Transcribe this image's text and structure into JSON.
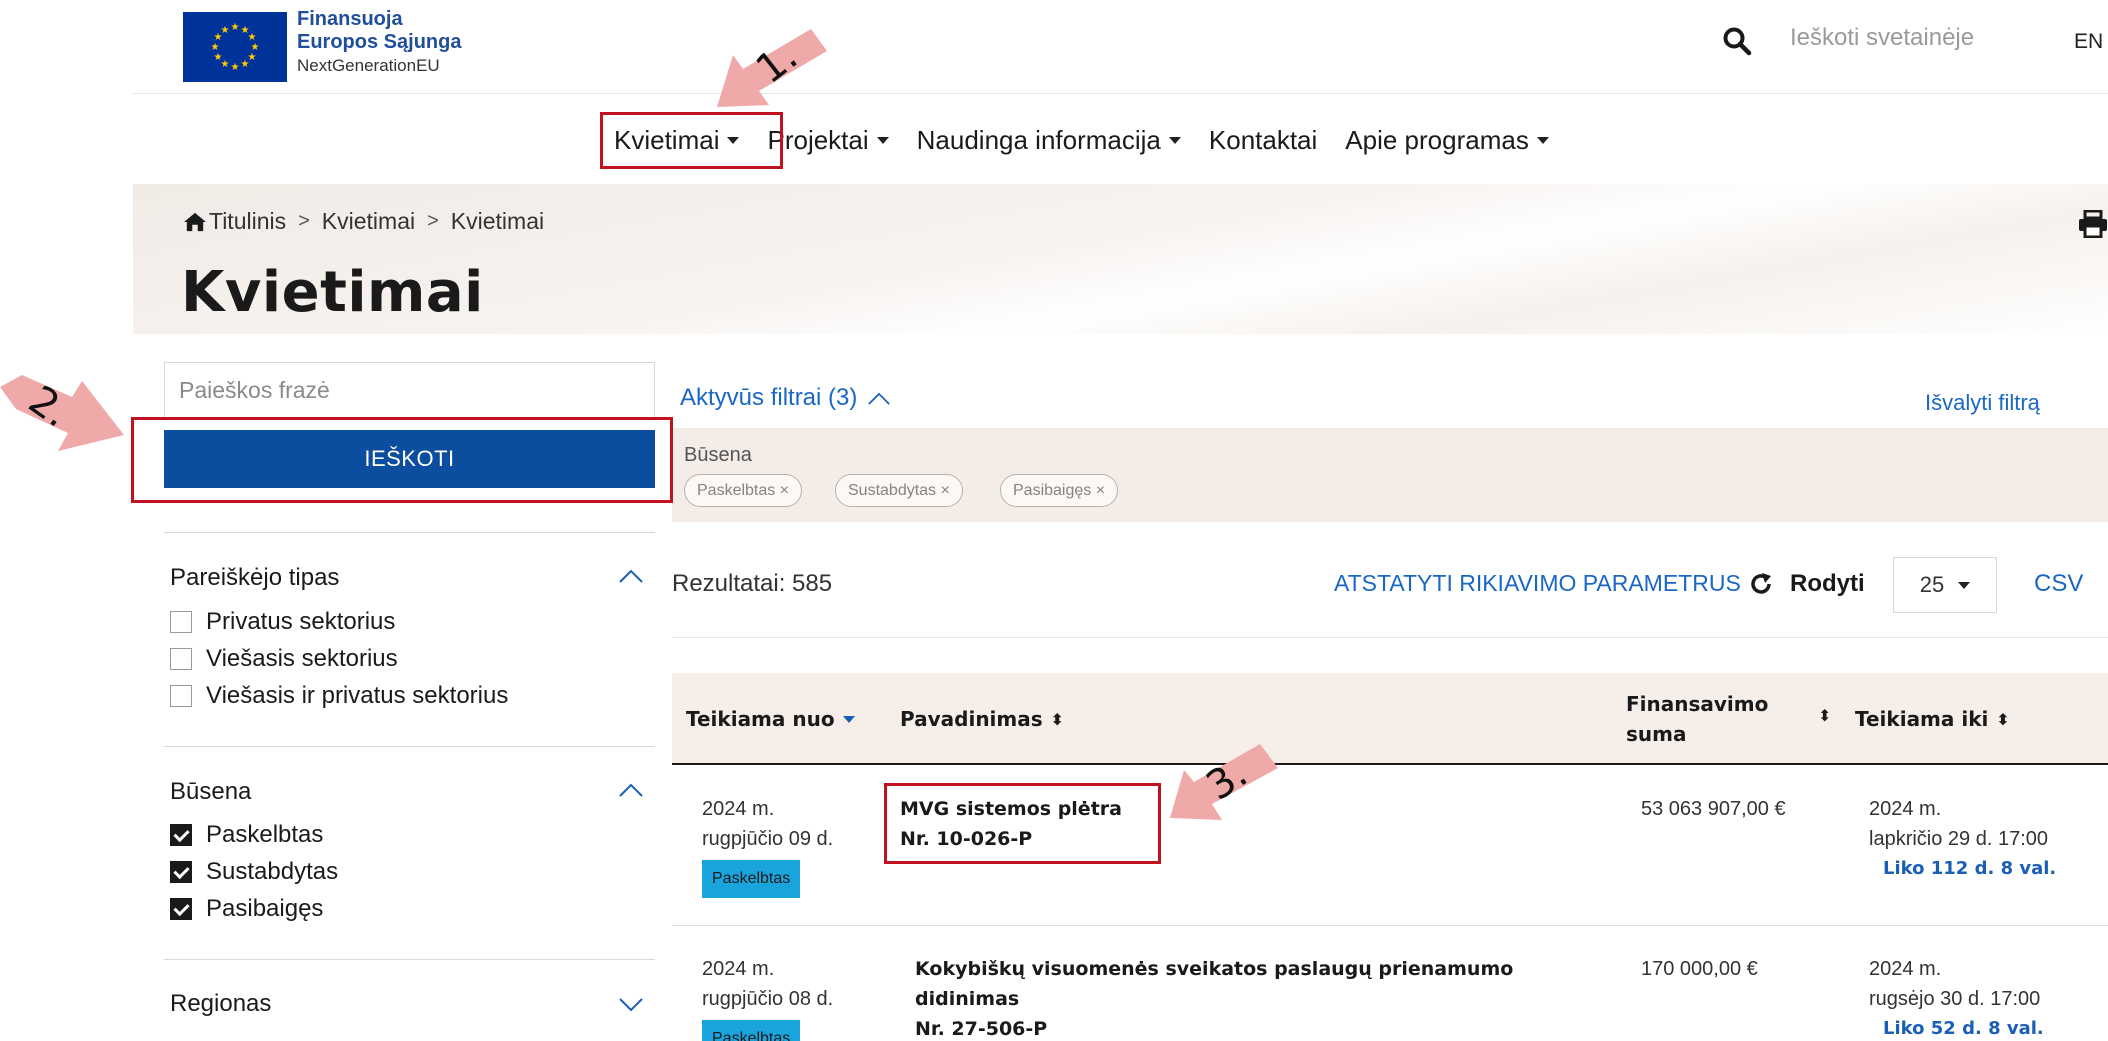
{
  "logo": {
    "line1": "Finansuoja",
    "line2": "Europos Sąjunga",
    "line3": "NextGenerationEU"
  },
  "header": {
    "search_placeholder": "Ieškoti svetainėje",
    "language": "EN",
    "search_icon": "search-icon"
  },
  "nav": {
    "items": [
      {
        "label": "Kvietimai",
        "dropdown": true
      },
      {
        "label": "Projektai",
        "dropdown": true
      },
      {
        "label": "Naudinga informacija",
        "dropdown": true
      },
      {
        "label": "Kontaktai",
        "dropdown": false
      },
      {
        "label": "Apie programas",
        "dropdown": true
      }
    ]
  },
  "breadcrumb": {
    "items": [
      "Titulinis",
      "Kvietimai",
      "Kvietimai"
    ],
    "separator": ">"
  },
  "page": {
    "title": "Kvietimai"
  },
  "search": {
    "placeholder": "Paieškos frazė",
    "button_label": "IEŠKOTI"
  },
  "facets": {
    "applicant": {
      "title": "Pareiškėjo tipas",
      "options": [
        {
          "label": "Privatus sektorius",
          "checked": false
        },
        {
          "label": "Viešasis sektorius",
          "checked": false
        },
        {
          "label": "Viešasis ir privatus sektorius",
          "checked": false
        }
      ]
    },
    "status": {
      "title": "Būsena",
      "options": [
        {
          "label": "Paskelbtas",
          "checked": true
        },
        {
          "label": "Sustabdytas",
          "checked": true
        },
        {
          "label": "Pasibaigęs",
          "checked": true
        }
      ]
    },
    "region": {
      "title": "Regionas"
    }
  },
  "active_filters": {
    "toggle_label": "Aktyvūs filtrai (3)",
    "clear_label": "Išvalyti filtrą",
    "group_label": "Būsena",
    "chips": [
      "Paskelbtas ×",
      "Sustabdytas ×",
      "Pasibaigęs ×"
    ]
  },
  "results": {
    "count_label": "Rezultatai: 585",
    "reset_label": "ATSTATYTI RIKIAVIMO PARAMETRUS",
    "show_label": "Rodyti",
    "per_page": "25",
    "csv_label": "CSV"
  },
  "table": {
    "headers": {
      "from": "Teikiama nuo",
      "name": "Pavadinimas",
      "amount_line1": "Finansavimo",
      "amount_line2": "suma",
      "to": "Teikiama iki"
    },
    "rows": [
      {
        "from_year": "2024 m.",
        "from_date": "rugpjūčio 09 d.",
        "status": "Paskelbtas",
        "title_line1": "MVG sistemos plėtra",
        "title_line2": "",
        "number": "Nr. 10-026-P",
        "amount": "53 063 907,00 €",
        "to_year": "2024 m.",
        "to_date": "lapkričio 29 d. 17:00",
        "remaining": "Liko 112 d. 8 val."
      },
      {
        "from_year": "2024 m.",
        "from_date": "rugpjūčio 08 d.",
        "status": "Paskelbtas",
        "title_line1": "Kokybiškų visuomenės sveikatos paslaugų prienamumo",
        "title_line2": "didinimas",
        "number": "Nr. 27-506-P",
        "amount": "170 000,00 €",
        "to_year": "2024 m.",
        "to_date": "rugsėjo 30 d. 17:00",
        "remaining": "Liko 52 d. 8 val."
      }
    ]
  },
  "annotations": {
    "step1": "1.",
    "step2": "2.",
    "step3": "3.",
    "highlight_color": "#c1121f",
    "arrow_color": "#f0a9a9"
  },
  "colors": {
    "primary_button": "#0b4d9e",
    "link": "#1a67c4",
    "status_badge": "#1aa4dc",
    "table_header_bg": "#f5eee9"
  }
}
